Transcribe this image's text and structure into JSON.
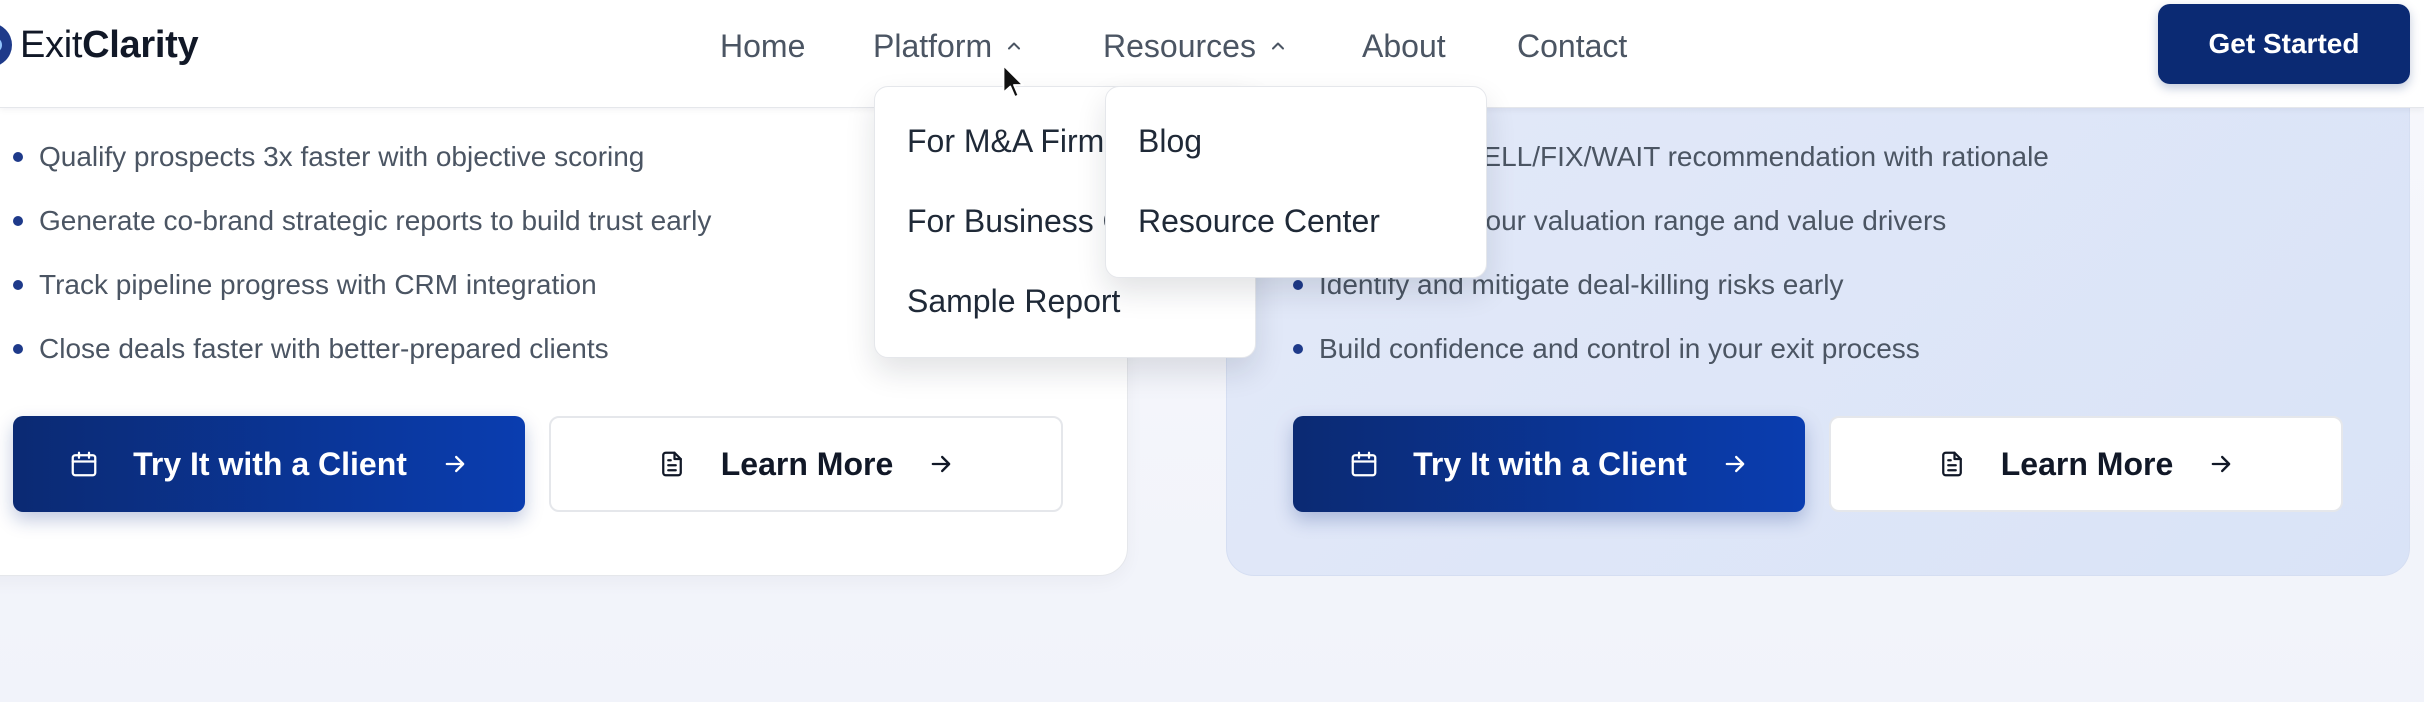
{
  "brand": {
    "name_regular": "Exit",
    "name_bold": "Clarity"
  },
  "nav": {
    "items": [
      {
        "label": "Home",
        "has_caret": false
      },
      {
        "label": "Platform",
        "has_caret": true
      },
      {
        "label": "Resources",
        "has_caret": true
      },
      {
        "label": "About",
        "has_caret": false
      },
      {
        "label": "Contact",
        "has_caret": false
      }
    ],
    "cta_label": "Get Started"
  },
  "dropdowns": {
    "platform": [
      "For M&A Firms",
      "For Business Owners",
      "Sample Report"
    ],
    "resources": [
      "Blog",
      "Resource Center"
    ]
  },
  "left_card": {
    "bullets": [
      "Qualify prospects 3x faster with objective scoring",
      "Generate co-brand strategic reports to build trust early",
      "Track pipeline progress with CRM integration",
      "Close deals faster with better-prepared clients"
    ],
    "primary_button": "Try It with a Client",
    "secondary_button": "Learn More"
  },
  "right_card": {
    "bullets": [
      "Get a clear SELL/FIX/WAIT recommendation with rationale",
      "Understand your valuation range and value drivers",
      "Identify and mitigate deal-killing risks early",
      "Build confidence and control in your exit process"
    ],
    "primary_button": "Try It with a Client",
    "secondary_button": "Learn More"
  },
  "icons": {
    "caret": "chevron-up-icon",
    "calendar": "calendar-icon",
    "document": "document-icon",
    "arrow": "arrow-right-icon"
  },
  "colors": {
    "brand_navy": "#0b2a73",
    "accent_blue": "#0a3db0",
    "bullet_dot": "#1e3a8a"
  }
}
